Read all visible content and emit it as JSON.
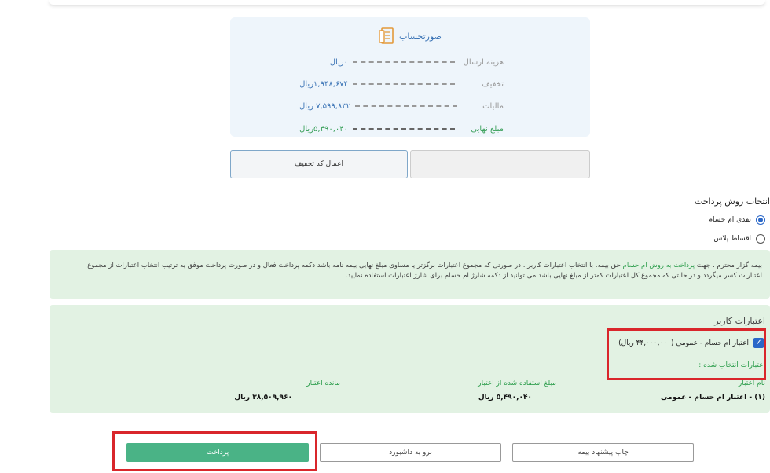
{
  "invoice": {
    "title": "صورتحساب",
    "rows": [
      {
        "label": "هزینه ارسال",
        "value": "۰ریال"
      },
      {
        "label": "تخفیف",
        "value": "۱,۹۴۸,۶۷۴ریال"
      },
      {
        "label": "مالیات",
        "value": "۷,۵۹۹,۸۳۲ ریال"
      },
      {
        "label": "مبلغ نهایی",
        "value": "۵,۴۹۰,۰۴۰ریال"
      }
    ]
  },
  "discount": {
    "apply_label": "اعمال کد تخفیف"
  },
  "payment_method": {
    "title": "انتخاب روش پرداخت",
    "options": [
      {
        "label": "نقدی ام حسام",
        "checked": true
      },
      {
        "label": "اقساط پلاس",
        "checked": false
      }
    ]
  },
  "notice": {
    "prefix": "بیمه گزار محترم ، جهت ",
    "highlight1": "پرداخت به روش ام حسام",
    "middle": " حق بیمه، با انتخاب اعتبارات کاربر ، در صورتی که مجموع اعتبارات برگزتر یا مساوی مبلغ نهایی بیمه نامه باشد دکمه پرداخت فعال و در صورت پرداخت موفق به ترتیب انتخاب اعتبارات از مجموع",
    "line2": "اعتبارات کسر میگردد و در حالتی که مجموع کل اعتبارات کمتر از مبلغ نهایی باشد می توانید از دکمه شارژ ام حسام برای شارژ اعتبارات استفاده نمایید."
  },
  "credits": {
    "heading": "اعتبارات کاربر",
    "checkbox_label": "اعتبار ام حسام - عمومی (۴۴,۰۰۰,۰۰۰ ریال)",
    "selected_title": "اعتبارات انتخاب شده :",
    "columns": {
      "name": "نام اعتبار",
      "used": "مبلغ استفاده شده از اعتبار",
      "remaining": "مانده اعتبار"
    },
    "row": {
      "name": "(۱) - اعتبار ام حسام - عمومی",
      "used": "۵,۴۹۰,۰۴۰ ریال",
      "remaining": "۳۸,۵۰۹,۹۶۰ ریال"
    }
  },
  "actions": {
    "print_label": "چاپ پیشنهاد بیمه",
    "dashboard_label": "برو به داشبورد",
    "pay_label": "پرداخت"
  },
  "colors": {
    "accent_blue": "#3a73b5",
    "green": "#4ab386",
    "highlight_red": "#d9262b",
    "notice_bg": "#e2f2e3"
  }
}
